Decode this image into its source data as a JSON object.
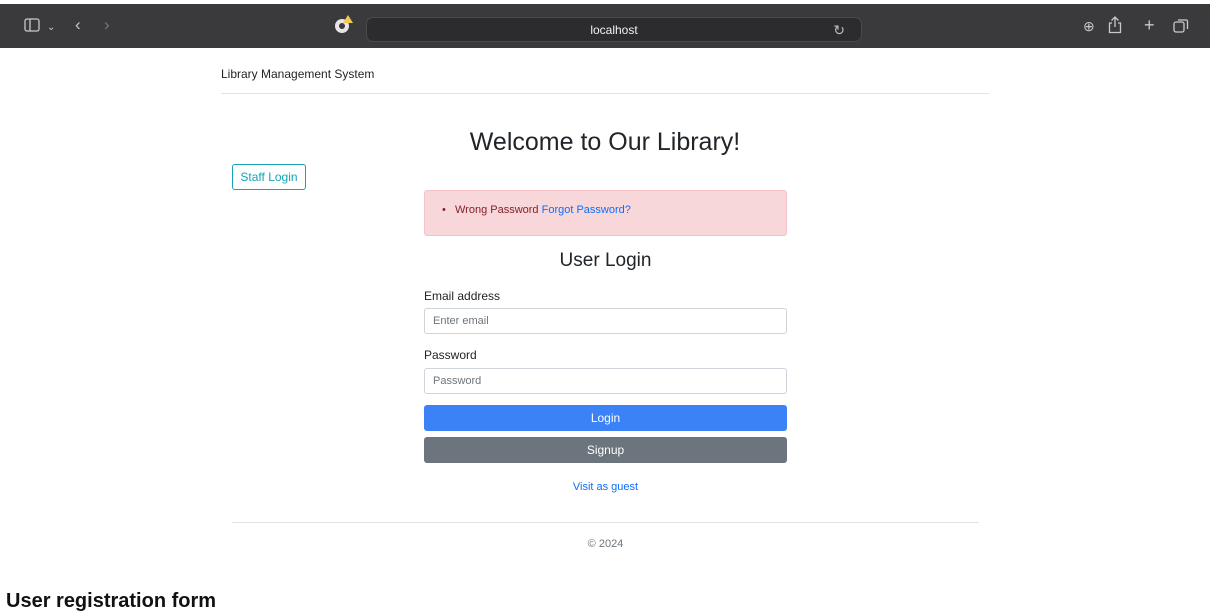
{
  "browser": {
    "url": "localhost",
    "icons": [
      "sidebar-icon",
      "chevron-down-icon",
      "back-icon",
      "forward-icon",
      "shield-icon",
      "reload-icon",
      "download-icon",
      "share-icon",
      "new-tab-icon",
      "tabs-icon"
    ]
  },
  "page": {
    "brand": "Library Management System",
    "welcome": "Welcome to Our Library!",
    "staff_login": "Staff Login",
    "alert": {
      "message": "Wrong Password",
      "link": "Forgot Password?"
    },
    "form": {
      "title": "User Login",
      "email_label": "Email address",
      "email_placeholder": "Enter email",
      "email_value": "",
      "password_label": "Password",
      "password_placeholder": "Password",
      "password_value": "",
      "login_button": "Login",
      "signup_button": "Signup",
      "guest_link": "Visit as guest"
    },
    "footer": "© 2024"
  },
  "captions": {
    "bottom": "User registration form"
  },
  "colors": {
    "primary": "#3a82f6",
    "secondary": "#6c757d",
    "info": "#17a2b8",
    "alert_bg": "#f8d7da",
    "browser_bar": "#3a3a3c"
  }
}
